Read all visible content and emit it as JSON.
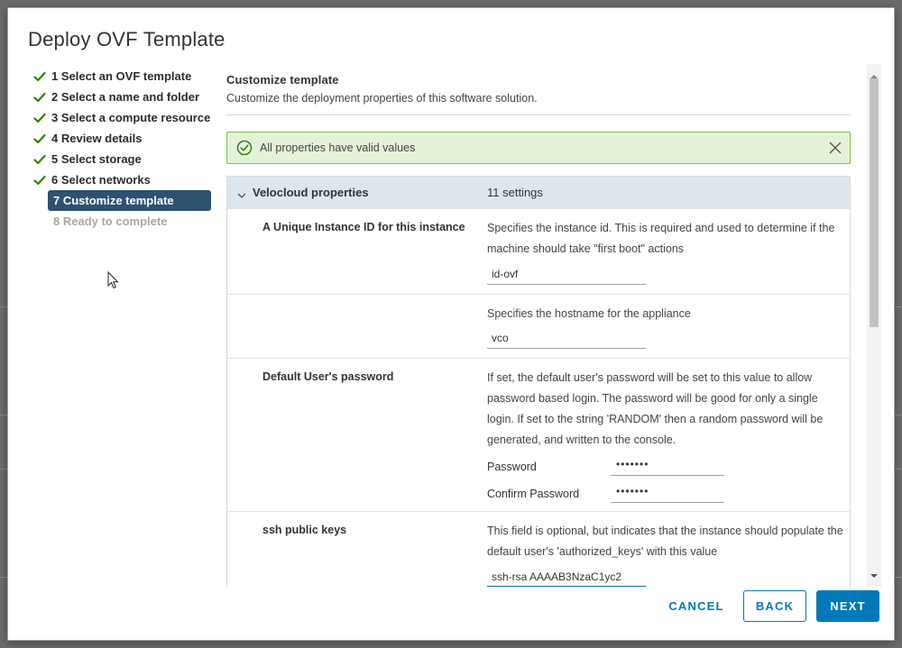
{
  "dialog": {
    "title": "Deploy OVF Template"
  },
  "steps": [
    {
      "label": "1 Select an OVF template",
      "state": "done"
    },
    {
      "label": "2 Select a name and folder",
      "state": "done"
    },
    {
      "label": "3 Select a compute resource",
      "state": "done"
    },
    {
      "label": "4 Review details",
      "state": "done"
    },
    {
      "label": "5 Select storage",
      "state": "done"
    },
    {
      "label": "6 Select networks",
      "state": "done"
    },
    {
      "label": "7 Customize template",
      "state": "active"
    },
    {
      "label": "8 Ready to complete",
      "state": "disabled"
    }
  ],
  "content": {
    "title": "Customize template",
    "description": "Customize the deployment properties of this software solution."
  },
  "alert": {
    "text": "All properties have valid values"
  },
  "properties": {
    "group_title": "Velocloud properties",
    "group_count": "11 settings",
    "rows": [
      {
        "label": "A Unique Instance ID for this instance",
        "description": "Specifies the instance id. This is required and used to determine if the machine should take \"first boot\" actions",
        "value": "id-ovf"
      },
      {
        "label": "",
        "description": "Specifies the hostname for the appliance",
        "value": "vco"
      },
      {
        "label": "Default User's password",
        "description": "If set, the default user's password will be set to this value to allow password based login. The password will be good for only a single login. If set to the string 'RANDOM' then a random password will be generated, and written to the console.",
        "password_label": "Password",
        "password_value": "•••••••",
        "confirm_label": "Confirm Password",
        "confirm_value": "•••••••"
      },
      {
        "label": "ssh public keys",
        "description": "This field is optional, but indicates that the instance should populate the default user's 'authorized_keys' with this value",
        "value": "ssh-rsa AAAAB3NzaC1yc2"
      }
    ]
  },
  "footer": {
    "cancel_label": "CANCEL",
    "back_label": "BACK",
    "next_label": "NEXT"
  },
  "colors": {
    "accent": "#0079b8",
    "active_step": "#2f5170",
    "success": "#7bbf44",
    "check": "#2f8400"
  }
}
